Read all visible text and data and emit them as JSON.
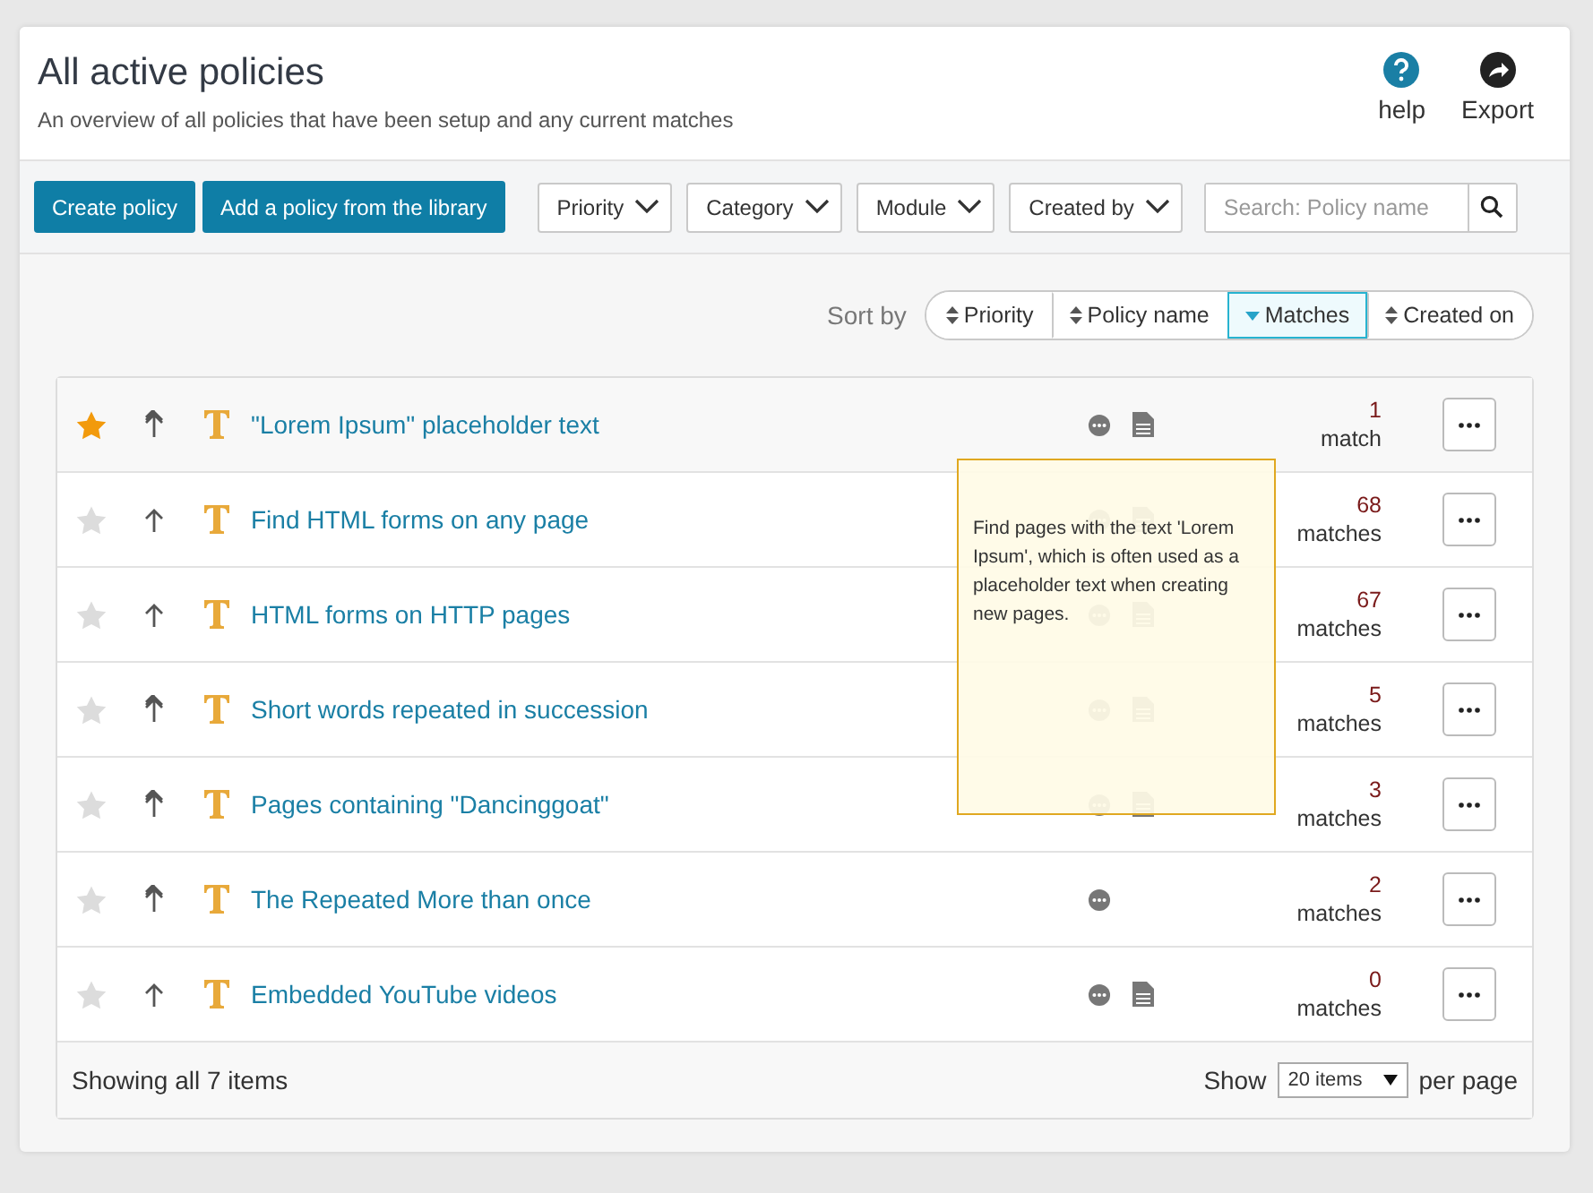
{
  "header": {
    "title": "All active policies",
    "subtitle": "An overview of all policies that have been setup and any current matches",
    "actions": [
      {
        "kind": "help",
        "label": "help"
      },
      {
        "kind": "export",
        "label": "Export"
      }
    ]
  },
  "toolbar": {
    "buttons": [
      "Create policy",
      "Add a policy from the library"
    ],
    "filters": [
      "Priority",
      "Category",
      "Module",
      "Created by"
    ],
    "search": {
      "placeholder": "Search: Policy name"
    }
  },
  "sort": {
    "label": "Sort by",
    "options": [
      {
        "label": "Priority",
        "selected": false
      },
      {
        "label": "Policy name",
        "selected": false
      },
      {
        "label": "Matches",
        "selected": true
      },
      {
        "label": "Created on",
        "selected": false
      }
    ]
  },
  "policies": [
    {
      "name": "\"Lorem Ipsum\" placeholder text",
      "starred": true,
      "high_priority": true,
      "highlighted": true,
      "comment": true,
      "document": true,
      "count": "1",
      "unit": "match"
    },
    {
      "name": "Find HTML forms on any page",
      "starred": false,
      "high_priority": false,
      "highlighted": false,
      "comment": true,
      "document": true,
      "count": "68",
      "unit": "matches"
    },
    {
      "name": "HTML forms on HTTP pages",
      "starred": false,
      "high_priority": false,
      "highlighted": false,
      "comment": true,
      "document": true,
      "count": "67",
      "unit": "matches"
    },
    {
      "name": "Short words repeated in succession",
      "starred": false,
      "high_priority": true,
      "highlighted": false,
      "comment": true,
      "document": true,
      "count": "5",
      "unit": "matches"
    },
    {
      "name": "Pages containing \"Dancinggoat\"",
      "starred": false,
      "high_priority": true,
      "highlighted": false,
      "comment": true,
      "document": true,
      "count": "3",
      "unit": "matches"
    },
    {
      "name": "The Repeated More than once",
      "starred": false,
      "high_priority": true,
      "highlighted": false,
      "comment": true,
      "document": false,
      "count": "2",
      "unit": "matches"
    },
    {
      "name": "Embedded YouTube videos",
      "starred": false,
      "high_priority": false,
      "highlighted": false,
      "comment": true,
      "document": true,
      "count": "0",
      "unit": "matches"
    }
  ],
  "tooltip": "Find pages with the text 'Lorem Ipsum', which is often used as a placeholder text when creating new pages.",
  "footer": {
    "summary": "Showing all 7 items",
    "show_label": "Show",
    "page_size": "20 items",
    "per_page": "per page"
  }
}
